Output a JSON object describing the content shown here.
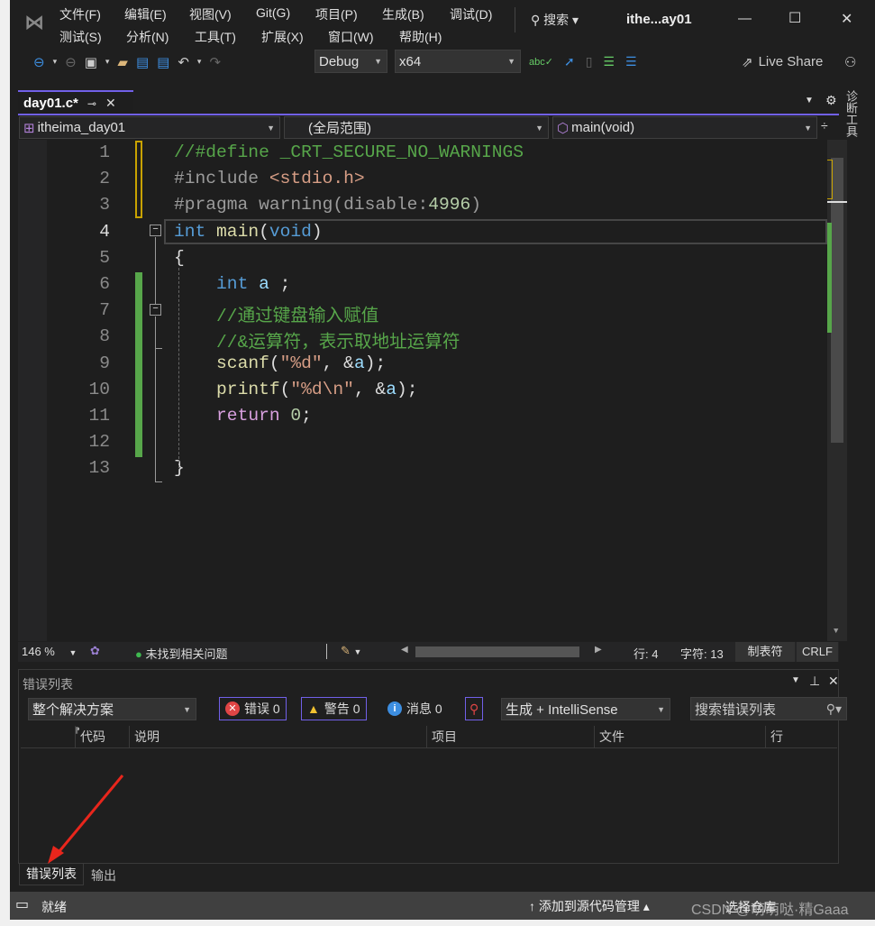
{
  "window": {
    "title": "ithe...ay01",
    "search_label": "搜索",
    "controls": [
      "—",
      "☐",
      "✕"
    ]
  },
  "menu": {
    "row1": [
      "文件(F)",
      "编辑(E)",
      "视图(V)",
      "Git(G)",
      "项目(P)",
      "生成(B)",
      "调试(D)"
    ],
    "row2": [
      "测试(S)",
      "分析(N)",
      "工具(T)",
      "扩展(X)",
      "窗口(W)",
      "帮助(H)"
    ]
  },
  "toolbar": {
    "configuration": "Debug",
    "platform": "x64",
    "live_share": "Live Share"
  },
  "tabs": [
    {
      "label": "day01.c*",
      "active": true
    }
  ],
  "right_tool_tab": "诊断工具",
  "navbar": {
    "project": "itheima_day01",
    "scope": "(全局范围)",
    "member": "main(void)"
  },
  "editor": {
    "current_line": 4,
    "lines": [
      [
        [
          "cm",
          "//#define _CRT_SECURE_NO_WARNINGS"
        ]
      ],
      [
        [
          "pp",
          "#include "
        ],
        [
          "st",
          "<stdio.h>"
        ]
      ],
      [
        [
          "pp",
          "#pragma warning(disable:"
        ],
        [
          "nu",
          "4996"
        ],
        [
          "pp",
          ")"
        ]
      ],
      [
        [
          "kw",
          "int "
        ],
        [
          "fn",
          "main"
        ],
        [
          "pl",
          "("
        ],
        [
          "kw",
          "void"
        ],
        [
          "pl",
          ")"
        ]
      ],
      [
        [
          "pl",
          "{"
        ]
      ],
      [
        [
          "pl",
          "    "
        ],
        [
          "kw",
          "int "
        ],
        [
          "va",
          "a"
        ],
        [
          "pl",
          " ;"
        ]
      ],
      [
        [
          "pl",
          "    "
        ],
        [
          "cm",
          "//通过键盘输入赋值"
        ]
      ],
      [
        [
          "pl",
          "    "
        ],
        [
          "cm",
          "//&运算符，表示取地址运算符"
        ]
      ],
      [
        [
          "pl",
          "    "
        ],
        [
          "fn",
          "scanf"
        ],
        [
          "pl",
          "("
        ],
        [
          "st",
          "\"%d\""
        ],
        [
          "pl",
          ", &"
        ],
        [
          "va",
          "a"
        ],
        [
          "pl",
          ");"
        ]
      ],
      [
        [
          "pl",
          "    "
        ],
        [
          "fn",
          "printf"
        ],
        [
          "pl",
          "("
        ],
        [
          "st",
          "\"%d\\n\""
        ],
        [
          "pl",
          ", &"
        ],
        [
          "va",
          "a"
        ],
        [
          "pl",
          ");"
        ]
      ],
      [
        [
          "pl",
          "    "
        ],
        [
          "ct",
          "return "
        ],
        [
          "nu",
          "0"
        ],
        [
          "pl",
          ";"
        ]
      ],
      [],
      [
        [
          "pl",
          "}"
        ]
      ]
    ]
  },
  "editor_status": {
    "zoom": "146 %",
    "issues": "未找到相关问题",
    "line": "行: 4",
    "char": "字符: 13",
    "indent": "制表符",
    "eol": "CRLF"
  },
  "error_list": {
    "title": "错误列表",
    "scope": "整个解决方案",
    "errors": "错误 0",
    "warnings": "警告 0",
    "messages": "消息 0",
    "source": "生成 + IntelliSense",
    "search_placeholder": "搜索错误列表",
    "columns": [
      "代码",
      "说明",
      "项目",
      "文件",
      "行"
    ]
  },
  "bottom_tabs": [
    "错误列表",
    "输出"
  ],
  "statusbar": {
    "ready": "就绪",
    "source_control": "添加到源代码管理",
    "repo": "选择仓库",
    "watermark": "CSDN @萌萌哒·精Gaaa"
  },
  "colors": {
    "accent": "#7160e8",
    "background": "#1f1f1f",
    "editor": "#1e1e1e",
    "change_saved": "#57a64a",
    "change_unsaved": "#c8a200"
  }
}
